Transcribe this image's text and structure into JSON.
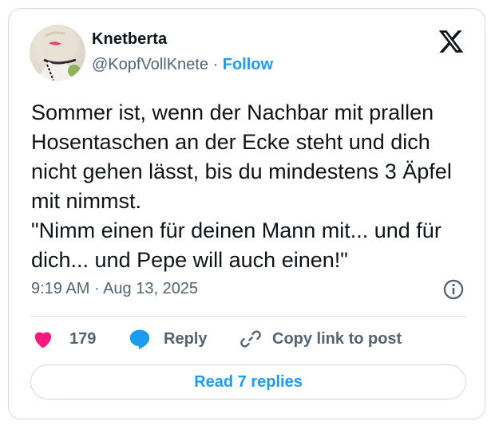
{
  "author": {
    "name": "Knetberta",
    "handle": "@KopfVollKnete",
    "separator": " · ",
    "follow_label": "Follow"
  },
  "tweet": {
    "text": "Sommer ist, wenn der Nachbar mit prallen Hosentaschen an der Ecke steht und dich nicht gehen lässt, bis du mindestens 3 Äpfel mit nimmst.\n\"Nimm einen für deinen Mann mit... und für dich... und Pepe will auch einen!\"",
    "time": "9:19 AM",
    "separator": " · ",
    "date": "Aug 13, 2025"
  },
  "actions": {
    "like_count": "179",
    "reply_label": "Reply",
    "copy_link_label": "Copy link to post"
  },
  "footer": {
    "read_replies_label": "Read 7 replies"
  },
  "icons": {
    "platform_logo": "x-logo-icon",
    "info": "info-icon",
    "like": "heart-icon",
    "reply": "speech-bubble-icon",
    "copy_link": "link-icon"
  },
  "colors": {
    "accent": "#1d9bf0",
    "like": "#f91880",
    "text_primary": "#0f1419",
    "text_secondary": "#536471",
    "border": "#cfd9de"
  }
}
